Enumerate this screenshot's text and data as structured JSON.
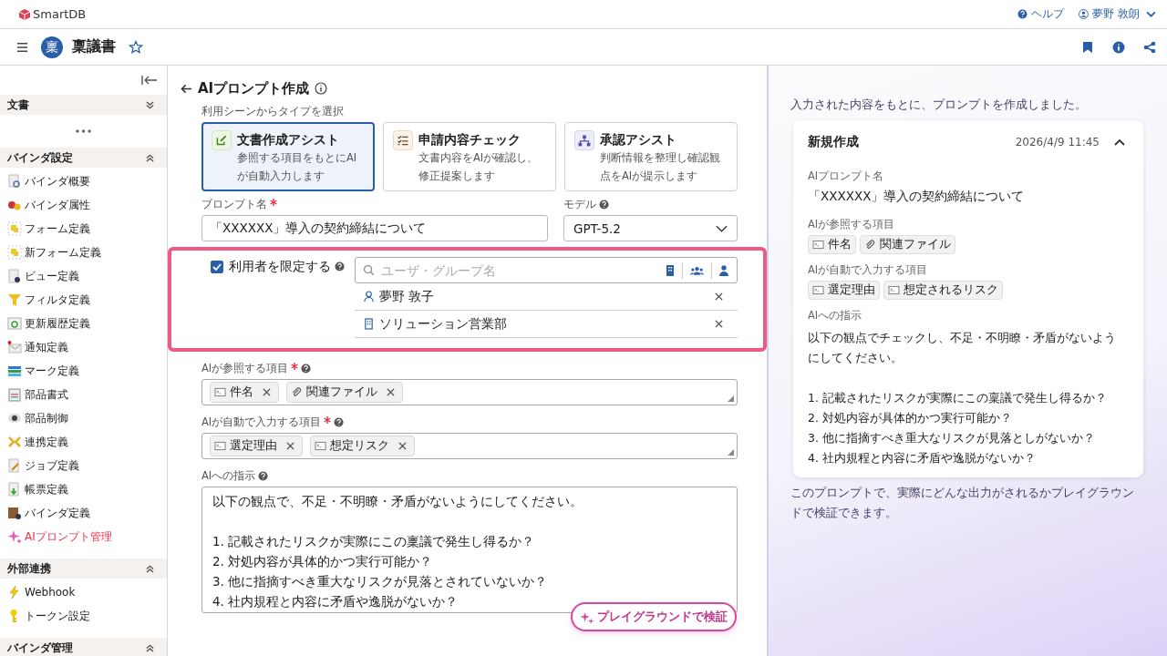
{
  "header": {
    "logo": "SmartDB",
    "help": "ヘルプ",
    "user": "夢野 敦朗"
  },
  "app_bar": {
    "badge": "稟",
    "title": "稟議書",
    "favorite": false
  },
  "sidebar": {
    "sections": [
      {
        "title": "文書",
        "expanded": false
      },
      {
        "title": "バインダ設定",
        "expanded": true,
        "items": [
          {
            "label": "バインダ概要",
            "selected": false
          },
          {
            "label": "バインダ属性",
            "selected": false
          },
          {
            "label": "フォーム定義",
            "selected": false
          },
          {
            "label": "新フォーム定義",
            "selected": false
          },
          {
            "label": "ビュー定義",
            "selected": false
          },
          {
            "label": "フィルタ定義",
            "selected": false
          },
          {
            "label": "更新履歴定義",
            "selected": false
          },
          {
            "label": "通知定義",
            "selected": false
          },
          {
            "label": "マーク定義",
            "selected": false
          },
          {
            "label": "部品書式",
            "selected": false
          },
          {
            "label": "部品制御",
            "selected": false
          },
          {
            "label": "連携定義",
            "selected": false
          },
          {
            "label": "ジョブ定義",
            "selected": false
          },
          {
            "label": "帳票定義",
            "selected": false
          },
          {
            "label": "バインダ定義",
            "selected": false
          },
          {
            "label": "AIプロンプト管理",
            "selected": true
          }
        ]
      },
      {
        "title": "外部連携",
        "expanded": true,
        "items": [
          {
            "label": "Webhook",
            "selected": false
          },
          {
            "label": "トークン設定",
            "selected": false
          }
        ]
      },
      {
        "title": "バインダ管理",
        "expanded": true
      }
    ]
  },
  "form": {
    "title": "AIプロンプト作成",
    "scene_label": "利用シーンからタイプを選択",
    "scenes": [
      {
        "kind": "write",
        "title": "文書作成アシスト",
        "description": "参照する項目をもとにAIが自動入力します",
        "selected": true
      },
      {
        "kind": "check",
        "title": "申請内容チェック",
        "description": "文書内容をAIが確認し、修正提案します",
        "selected": false
      },
      {
        "kind": "approve",
        "title": "承認アシスト",
        "description": "判断情報を整理し確認観点をAIが提示します",
        "selected": false
      }
    ],
    "prompt_name": {
      "label": "プロンプト名",
      "required": true,
      "value": "「XXXXXX」導入の契約締結について"
    },
    "model": {
      "label": "モデル",
      "value": "GPT-5.2"
    },
    "restrict": {
      "label": "利用者を限定する",
      "checked": true,
      "placeholder": "ユーザ・グループ名",
      "highlighted": true,
      "members": [
        {
          "kind": "user",
          "name": "夢野 敦子"
        },
        {
          "kind": "group",
          "name": "ソリューション営業部"
        }
      ]
    },
    "reference_items": {
      "label": "AIが参照する項目",
      "required": true,
      "tags": [
        {
          "kind": "text",
          "label": "件名"
        },
        {
          "kind": "file",
          "label": "関連ファイル"
        }
      ]
    },
    "output_items": {
      "label": "AIが自動で入力する項目",
      "required": true,
      "tags": [
        {
          "kind": "textarea",
          "label": "選定理由"
        },
        {
          "kind": "textarea",
          "label": "想定リスク"
        }
      ]
    },
    "instruction": {
      "label": "AIへの指示",
      "value": "以下の観点で、不足・不明瞭・矛盾がないようにしてください。\n\n1. 記載されたリスクが実際にこの稟議で発生し得るか？\n2. 対処内容が具体的かつ実行可能か？\n3. 他に指摘すべき重大なリスクが見落とされていないか？\n4. 社内規程と内容に矛盾や逸脱がないか？"
    },
    "playground_button": "プレイグラウンドで検証"
  },
  "preview": {
    "intro": "入力された内容をもとに、プロンプトを作成しました。",
    "card": {
      "title": "新規作成",
      "timestamp": "2026/4/9 11:45",
      "expanded": true,
      "name_label": "AIプロンプト名",
      "name_value": "「XXXXXX」導入の契約締結について",
      "reference_label": "AIが参照する項目",
      "reference_tags": [
        {
          "kind": "text",
          "label": "件名"
        },
        {
          "kind": "file",
          "label": "関連ファイル"
        }
      ],
      "output_label": "AIが自動で入力する項目",
      "output_tags": [
        {
          "kind": "textarea",
          "label": "選定理由"
        },
        {
          "kind": "textarea",
          "label": "想定されるリスク"
        }
      ],
      "instruction_label": "AIへの指示",
      "instruction_value": "以下の観点でチェックし、不足・不明瞭・矛盾がないようにしてください。\n\n1. 記載されたリスクが実際にこの稟議で発生し得るか？\n2. 対処内容が具体的かつ実行可能か？\n3. 他に指摘すべき重大なリスクが見落としがないか？\n4. 社内規程と内容に矛盾や逸脱がないか？"
    },
    "outro": "このプロンプトで、実際にどんな出力がされるかプレイグラウンドで検証できます。"
  }
}
